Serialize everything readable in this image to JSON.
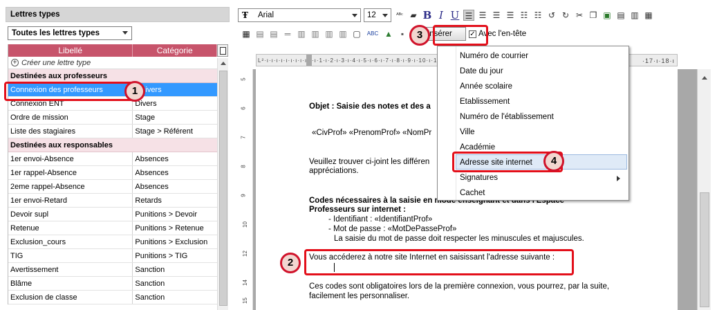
{
  "left_panel": {
    "title": "Lettres types",
    "filter": "Toutes les lettres types",
    "columns": [
      "Libellé",
      "Catégorie"
    ],
    "create_label": "Créer une lettre type",
    "groups": [
      {
        "title": "Destinées aux professeurs",
        "rows": [
          {
            "label": "Connexion des professeurs",
            "category": "ivers"
          },
          {
            "label": "Connexion ENT",
            "category": "Divers"
          },
          {
            "label": "Ordre de mission",
            "category": "Stage"
          },
          {
            "label": "Liste des stagiaires",
            "category": "Stage > Référent"
          }
        ]
      },
      {
        "title": "Destinées aux responsables",
        "rows": [
          {
            "label": "1er envoi-Absence",
            "category": "Absences"
          },
          {
            "label": "1er rappel-Absence",
            "category": "Absences"
          },
          {
            "label": "2eme rappel-Absence",
            "category": "Absences"
          },
          {
            "label": "1er envoi-Retard",
            "category": "Retards"
          },
          {
            "label": "Devoir supl",
            "category": "Punitions > Devoir"
          },
          {
            "label": "Retenue",
            "category": "Punitions > Retenue"
          },
          {
            "label": "Exclusion_cours",
            "category": "Punitions > Exclusion"
          },
          {
            "label": "TIG",
            "category": "Punitions > TIG"
          },
          {
            "label": "Avertissement",
            "category": "Sanction"
          },
          {
            "label": "Blâme",
            "category": "Sanction"
          },
          {
            "label": "Exclusion de classe",
            "category": "Sanction"
          }
        ]
      }
    ]
  },
  "toolbar": {
    "font": "Arial",
    "size": "12",
    "insert_label": "Insérer",
    "header_checkbox": "Avec l'en-tête",
    "header_checked": true,
    "abc_label": "ABC"
  },
  "ruler": {
    "text": "L²·ı·ı·ı·ı·ı·ı·ı·ı·ı·ı·ı·1·ı·2·ı·3·ı·4·ı·5·ı·6·ı·7·ı·8·ı·9·ı·10·ı·11·ı·12·ı·13·ı·14·ı·15·ı·16·ı·17·ı·18",
    "last": "·17·ı·18·ı"
  },
  "document": {
    "objet": "Objet : Saisie des notes et des a",
    "civ": "«CivProf» «PrenomProf» «NomPr",
    "para1a": "Veuillez trouver ci-joint les différen",
    "para1b": "appréciations.",
    "codes_a": "Codes nécessaires à la saisie en mode enseignant et dans l'Espace",
    "codes_b": "Professeurs sur internet :",
    "ident": "- Identifiant : «IdentifiantProf»",
    "pass": "- Mot de passe : «MotDePasseProf»",
    "pass_note": "La saisie du mot de passe doit respecter les minuscules et majuscules.",
    "access": "Vous accéderez à notre site Internet en saisissant l'adresse suivante :",
    "closing_a": "Ces codes sont obligatoires lors de la première connexion, vous pourrez, par la suite,",
    "closing_b": "facilement les personnaliser."
  },
  "insert_menu": {
    "items": [
      "Numéro de courrier",
      "Date du jour",
      "Année scolaire",
      "Etablissement",
      "Numéro de l'établissement",
      "Ville",
      "Académie",
      "Adresse site internet",
      "Signatures",
      "Cachet"
    ],
    "highlighted": "Adresse site internet"
  },
  "callouts": [
    "1",
    "2",
    "3",
    "4"
  ],
  "colors": {
    "header_pink": "#c7546b",
    "group_pink": "#f6e1e6",
    "selection_blue": "#3399ff",
    "callout_red": "#e30f1a"
  }
}
